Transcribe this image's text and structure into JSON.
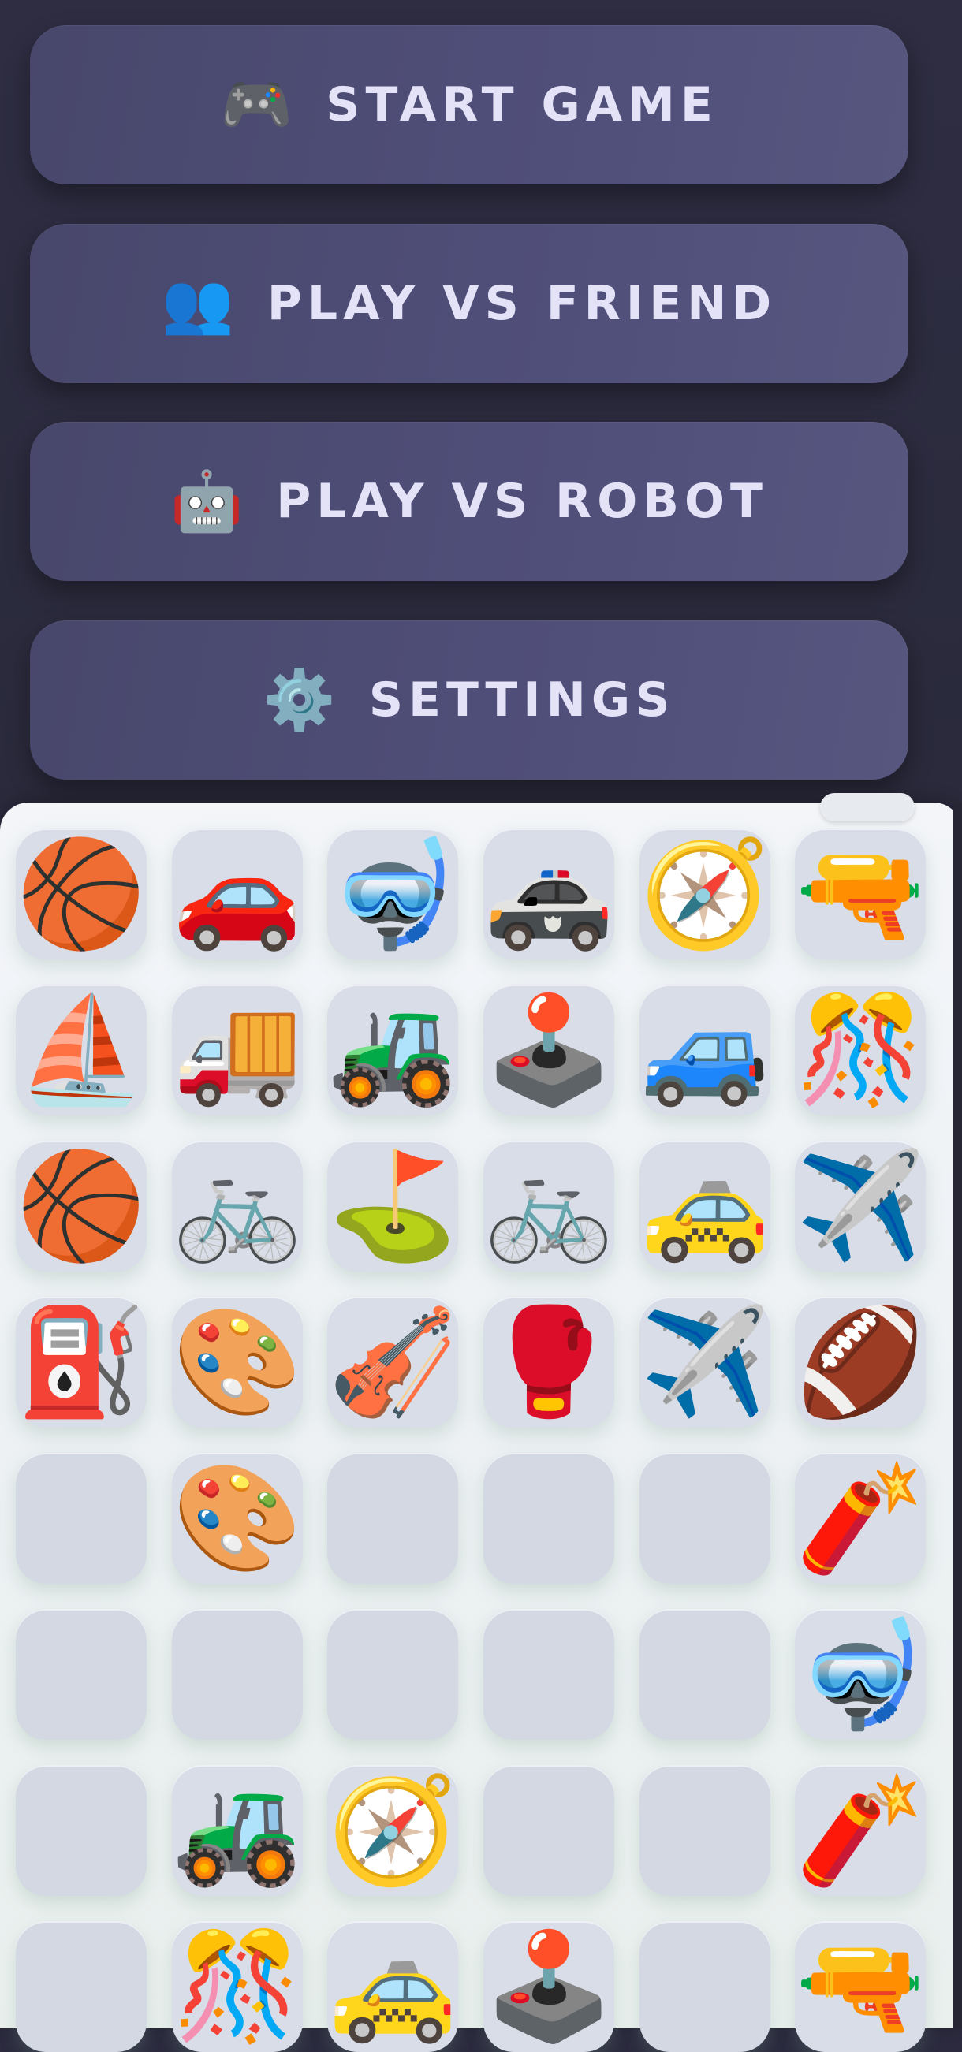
{
  "menu": {
    "buttons": [
      {
        "label": "START GAME",
        "icon": "🎮",
        "icon_name": "game-controller-icon"
      },
      {
        "label": "PLAY VS FRIEND",
        "icon": "👥",
        "icon_name": "friends-icon"
      },
      {
        "label": "PLAY VS ROBOT",
        "icon": "🤖",
        "icon_name": "robot-icon"
      },
      {
        "label": "SETTINGS",
        "icon": "⚙️",
        "icon_name": "gear-icon"
      }
    ]
  },
  "board": {
    "columns": 6,
    "rows": [
      [
        {
          "name": "basketball",
          "icon": "🏀",
          "color": "#e8662b"
        },
        {
          "name": "car",
          "icon": "🚗",
          "color": "#e53935"
        },
        {
          "name": "diving-mask",
          "icon": "🤿",
          "color": "#2b8fd4"
        },
        {
          "name": "police-car",
          "icon": "🚓",
          "color": "#37474f"
        },
        {
          "name": "compass",
          "icon": "🧭",
          "color": "#f2b632"
        },
        {
          "name": "water-pistol",
          "icon": "🔫",
          "color": "#ff9a1f"
        }
      ],
      [
        {
          "name": "sailboat",
          "icon": "⛵",
          "color": "#e6693e"
        },
        {
          "name": "delivery-truck",
          "icon": "🚚",
          "color": "#e3a33a"
        },
        {
          "name": "tractor",
          "icon": "🚜",
          "color": "#3aa64b"
        },
        {
          "name": "joystick",
          "icon": "🕹️",
          "color": "#e53935"
        },
        {
          "name": "suv",
          "icon": "🚙",
          "color": "#2f6fd1"
        },
        {
          "name": "confetti",
          "icon": "🎊",
          "color": "#f2b632"
        }
      ],
      [
        {
          "name": "basketball",
          "icon": "🏀",
          "color": "#e8662b"
        },
        {
          "name": "bicycle",
          "icon": "🚲",
          "color": "#5a9ca3"
        },
        {
          "name": "golf-flag",
          "icon": "⛳",
          "color": "#7cb342"
        },
        {
          "name": "bicycle",
          "icon": "🚲",
          "color": "#5a9ca3"
        },
        {
          "name": "taxi",
          "icon": "🚕",
          "color": "#f5c518"
        },
        {
          "name": "airplane",
          "icon": "✈️",
          "color": "#1e6fc1"
        }
      ],
      [
        {
          "name": "fuel-pump",
          "icon": "⛽",
          "color": "#e53935"
        },
        {
          "name": "artist-palette",
          "icon": "🎨",
          "color": "#e89a50"
        },
        {
          "name": "violin",
          "icon": "🎻",
          "color": "#b5552a"
        },
        {
          "name": "boxing-glove",
          "icon": "🥊",
          "color": "#d32f2f"
        },
        {
          "name": "airplane",
          "icon": "✈️",
          "color": "#1e6fc1"
        },
        {
          "name": "football",
          "icon": "🏈",
          "color": "#7b3a1e"
        }
      ],
      [
        {
          "name": "",
          "icon": "",
          "color": ""
        },
        {
          "name": "artist-palette",
          "icon": "🎨",
          "color": "#e89a50"
        },
        {
          "name": "",
          "icon": "",
          "color": ""
        },
        {
          "name": "",
          "icon": "",
          "color": ""
        },
        {
          "name": "",
          "icon": "",
          "color": ""
        },
        {
          "name": "firecracker",
          "icon": "🧨",
          "color": "#d32f2f"
        }
      ],
      [
        {
          "name": "",
          "icon": "",
          "color": ""
        },
        {
          "name": "",
          "icon": "",
          "color": ""
        },
        {
          "name": "",
          "icon": "",
          "color": ""
        },
        {
          "name": "",
          "icon": "",
          "color": ""
        },
        {
          "name": "",
          "icon": "",
          "color": ""
        },
        {
          "name": "diving-mask",
          "icon": "🤿",
          "color": "#2b8fd4"
        }
      ],
      [
        {
          "name": "",
          "icon": "",
          "color": ""
        },
        {
          "name": "tractor",
          "icon": "🚜",
          "color": "#3aa64b"
        },
        {
          "name": "compass",
          "icon": "🧭",
          "color": "#f2b632"
        },
        {
          "name": "",
          "icon": "",
          "color": ""
        },
        {
          "name": "",
          "icon": "",
          "color": ""
        },
        {
          "name": "firecracker",
          "icon": "🧨",
          "color": "#d32f2f"
        }
      ],
      [
        {
          "name": "",
          "icon": "",
          "color": ""
        },
        {
          "name": "confetti",
          "icon": "🎊",
          "color": "#f2b632"
        },
        {
          "name": "taxi",
          "icon": "🚕",
          "color": "#f5c518"
        },
        {
          "name": "joystick",
          "icon": "🕹️",
          "color": "#e53935"
        },
        {
          "name": "",
          "icon": "",
          "color": ""
        },
        {
          "name": "water-pistol",
          "icon": "🔫",
          "color": "#ff9a1f"
        }
      ]
    ]
  }
}
